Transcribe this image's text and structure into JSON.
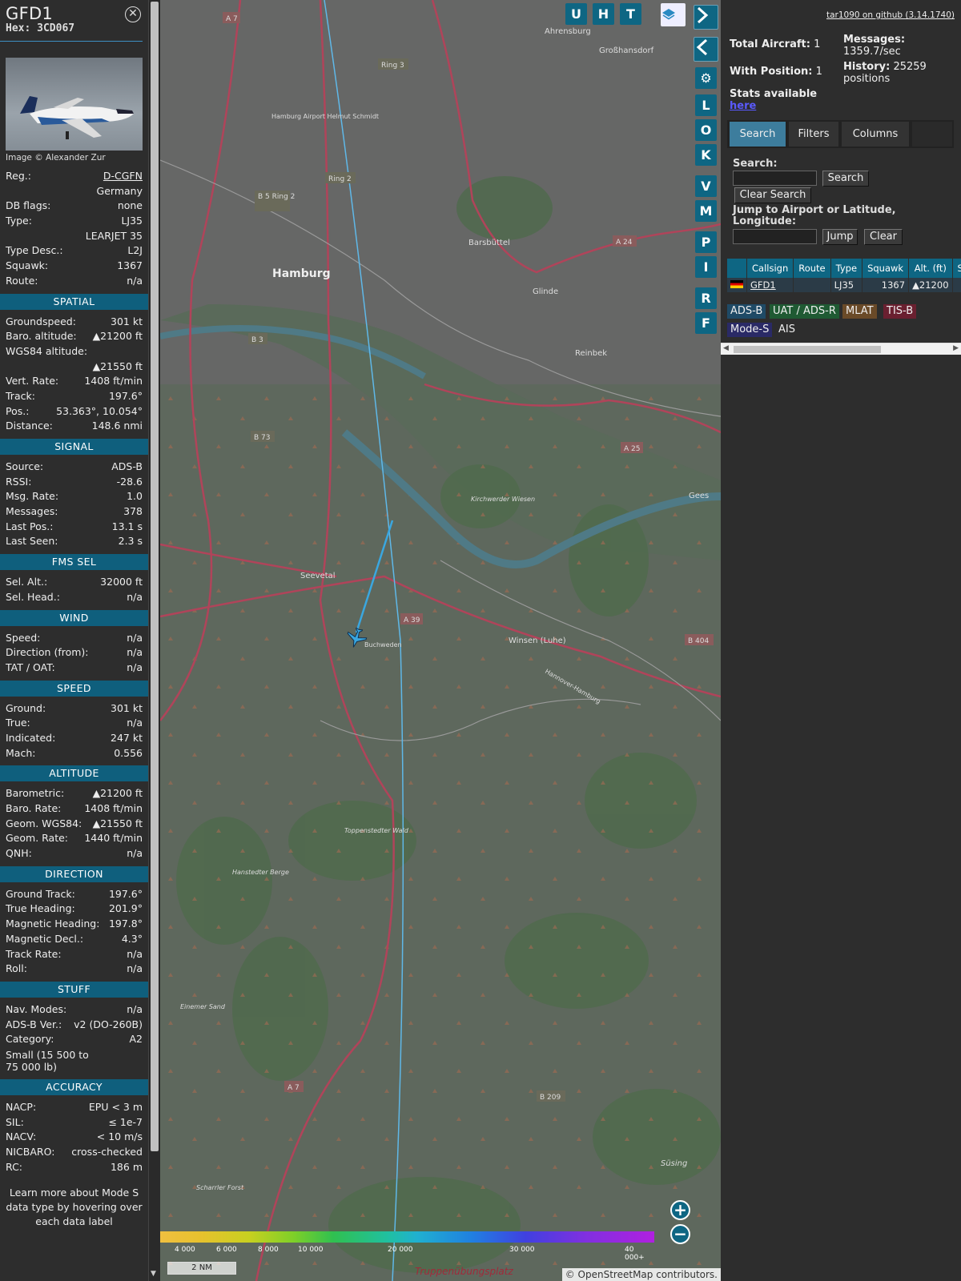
{
  "aircraft": {
    "callsign": "GFD1",
    "hex_label": "Hex:",
    "hex": "3CD067",
    "close_icon": "close-icon",
    "photo_credit": "Image © Alexander Zur",
    "fields": [
      {
        "k": "Reg.:",
        "v": "D-CGFN",
        "link": true
      },
      {
        "k": "",
        "v": "Germany"
      },
      {
        "k": "DB flags:",
        "v": "none"
      },
      {
        "k": "Type:",
        "v": "LJ35"
      },
      {
        "k": "",
        "v": "LEARJET 35"
      },
      {
        "k": "Type Desc.:",
        "v": "L2J"
      },
      {
        "k": "Squawk:",
        "v": "1367"
      },
      {
        "k": "Route:",
        "v": "n/a"
      }
    ]
  },
  "sections": {
    "spatial": {
      "title": "SPATIAL",
      "rows": [
        {
          "k": "Groundspeed:",
          "v": "301 kt"
        },
        {
          "k": "Baro. altitude:",
          "v": "▲21200 ft"
        },
        {
          "k": "WGS84 altitude:",
          "v": ""
        },
        {
          "k": "",
          "v": "▲21550 ft"
        },
        {
          "k": "Vert. Rate:",
          "v": "1408 ft/min"
        },
        {
          "k": "Track:",
          "v": "197.6°"
        },
        {
          "k": "Pos.:",
          "v": "53.363°, 10.054°"
        },
        {
          "k": "Distance:",
          "v": "148.6 nmi"
        }
      ]
    },
    "signal": {
      "title": "SIGNAL",
      "rows": [
        {
          "k": "Source:",
          "v": "ADS-B"
        },
        {
          "k": "RSSI:",
          "v": "-28.6"
        },
        {
          "k": "Msg. Rate:",
          "v": "1.0"
        },
        {
          "k": "Messages:",
          "v": "378"
        },
        {
          "k": "Last Pos.:",
          "v": "13.1 s"
        },
        {
          "k": "Last Seen:",
          "v": "2.3 s"
        }
      ]
    },
    "fms": {
      "title": "FMS SEL",
      "rows": [
        {
          "k": "Sel. Alt.:",
          "v": "32000 ft"
        },
        {
          "k": "Sel. Head.:",
          "v": "n/a"
        }
      ]
    },
    "wind": {
      "title": "WIND",
      "rows": [
        {
          "k": "Speed:",
          "v": "n/a"
        },
        {
          "k": "Direction (from):",
          "v": "n/a"
        },
        {
          "k": "TAT / OAT:",
          "v": "n/a"
        }
      ]
    },
    "speed": {
      "title": "SPEED",
      "rows": [
        {
          "k": "Ground:",
          "v": "301 kt"
        },
        {
          "k": "True:",
          "v": "n/a"
        },
        {
          "k": "Indicated:",
          "v": "247 kt"
        },
        {
          "k": "Mach:",
          "v": "0.556"
        }
      ]
    },
    "altitude": {
      "title": "ALTITUDE",
      "rows": [
        {
          "k": "Barometric:",
          "v": "▲21200 ft"
        },
        {
          "k": "Baro. Rate:",
          "v": "1408 ft/min"
        },
        {
          "k": "Geom. WGS84:",
          "v": "▲21550 ft"
        },
        {
          "k": "Geom. Rate:",
          "v": "1440 ft/min"
        },
        {
          "k": "QNH:",
          "v": "n/a"
        }
      ]
    },
    "direction": {
      "title": "DIRECTION",
      "rows": [
        {
          "k": "Ground Track:",
          "v": "197.6°"
        },
        {
          "k": "True Heading:",
          "v": "201.9°"
        },
        {
          "k": "Magnetic Heading:",
          "v": "197.8°"
        },
        {
          "k": "Magnetic Decl.:",
          "v": "4.3°"
        },
        {
          "k": "Track Rate:",
          "v": "n/a"
        },
        {
          "k": "Roll:",
          "v": "n/a"
        }
      ]
    },
    "stuff": {
      "title": "STUFF",
      "rows": [
        {
          "k": "Nav. Modes:",
          "v": "n/a"
        },
        {
          "k": "ADS-B Ver.:",
          "v": "v2 (DO-260B)"
        },
        {
          "k": "Category:",
          "v": "A2"
        }
      ],
      "category_desc": "Small (15 500 to 75 000 lb)"
    },
    "accuracy": {
      "title": "ACCURACY",
      "rows": [
        {
          "k": "NACP:",
          "v": "EPU < 3 m"
        },
        {
          "k": "SIL:",
          "v": "≤ 1e-7"
        },
        {
          "k": "NACV:",
          "v": "< 10 m/s"
        },
        {
          "k": "NICBARO:",
          "v": "cross-checked"
        },
        {
          "k": "RC:",
          "v": "186 m"
        }
      ]
    },
    "footnote": "Learn more about Mode S data type by hovering over each data label"
  },
  "map": {
    "places": [
      "Hamburg",
      "Ahrensburg",
      "Großhansdorf",
      "Barsbüttel",
      "Glinde",
      "Reinbek",
      "Seevetal",
      "Buchweden",
      "Winsen (Luhe)",
      "Hamburg Airport Helmut Schmidt",
      "Kirchwerder Wiesen",
      "Toppenstedter Wald",
      "Hanstedter Berge",
      "Einemer Sand",
      "Scharrler Forst",
      "Süsing",
      "Truppenübungsplatz",
      "Gees",
      "Hannover-Hamburg"
    ],
    "road_labels": [
      "A 7",
      "Ring 3",
      "Ring 2",
      "B 5 Ring 2",
      "A 24",
      "B 3",
      "B 73",
      "A 25",
      "A 39",
      "B 404",
      "A 7",
      "B 209"
    ],
    "buttons_letters": [
      "U",
      "H",
      "T"
    ],
    "side_buttons": [
      "L",
      "O",
      "K",
      "V",
      "M",
      "P",
      "I",
      "R",
      "F"
    ],
    "icons": [
      "layers-icon",
      "chevron-right-icon",
      "chevron-left-icon",
      "expand-arrows-icon",
      "gear-icon",
      "airplane-icon",
      "zoom-in-icon",
      "zoom-out-icon"
    ],
    "altitude_scale": [
      "4 000",
      "6 000",
      "8 000",
      "10 000",
      "20 000",
      "30 000",
      "40 000+"
    ],
    "scale_bar": "2 NM",
    "attribution": "© OpenStreetMap contributors."
  },
  "right": {
    "github": "tar1090 on github (3.14.1740)",
    "total_label": "Total Aircraft:",
    "total": "1",
    "messages_label": "Messages:",
    "messages": "1359.7/sec",
    "with_pos_label": "With Position:",
    "with_pos": "1",
    "history_label": "History:",
    "history": "25259 positions",
    "stats_text": "Stats available",
    "stats_link": "here",
    "tabs": [
      "Search",
      "Filters",
      "Columns"
    ],
    "search_label": "Search:",
    "search_btn": "Search",
    "clear_search_btn": "Clear Search",
    "jump_label": "Jump to Airport or Latitude, Longitude:",
    "jump_btn": "Jump",
    "clear_btn": "Clear",
    "table": {
      "headers": [
        "",
        "Callsign",
        "Route",
        "Type",
        "Squawk",
        "Alt. (ft)",
        "Spd"
      ],
      "row": {
        "callsign": "GFD1",
        "route": "",
        "type": "LJ35",
        "squawk": "1367",
        "alt": "▲21200"
      }
    },
    "tags": [
      {
        "label": "ADS-B",
        "color": "#1f4a66"
      },
      {
        "label": "UAT / ADS-R",
        "color": "#1f5a33"
      },
      {
        "label": "MLAT",
        "color": "#6a4a28"
      },
      {
        "label": "TIS-B",
        "color": "#6a2030"
      },
      {
        "label": "Mode-S",
        "color": "#2a2a66"
      },
      {
        "label": "AIS",
        "color": "#2d2d2d"
      }
    ]
  }
}
